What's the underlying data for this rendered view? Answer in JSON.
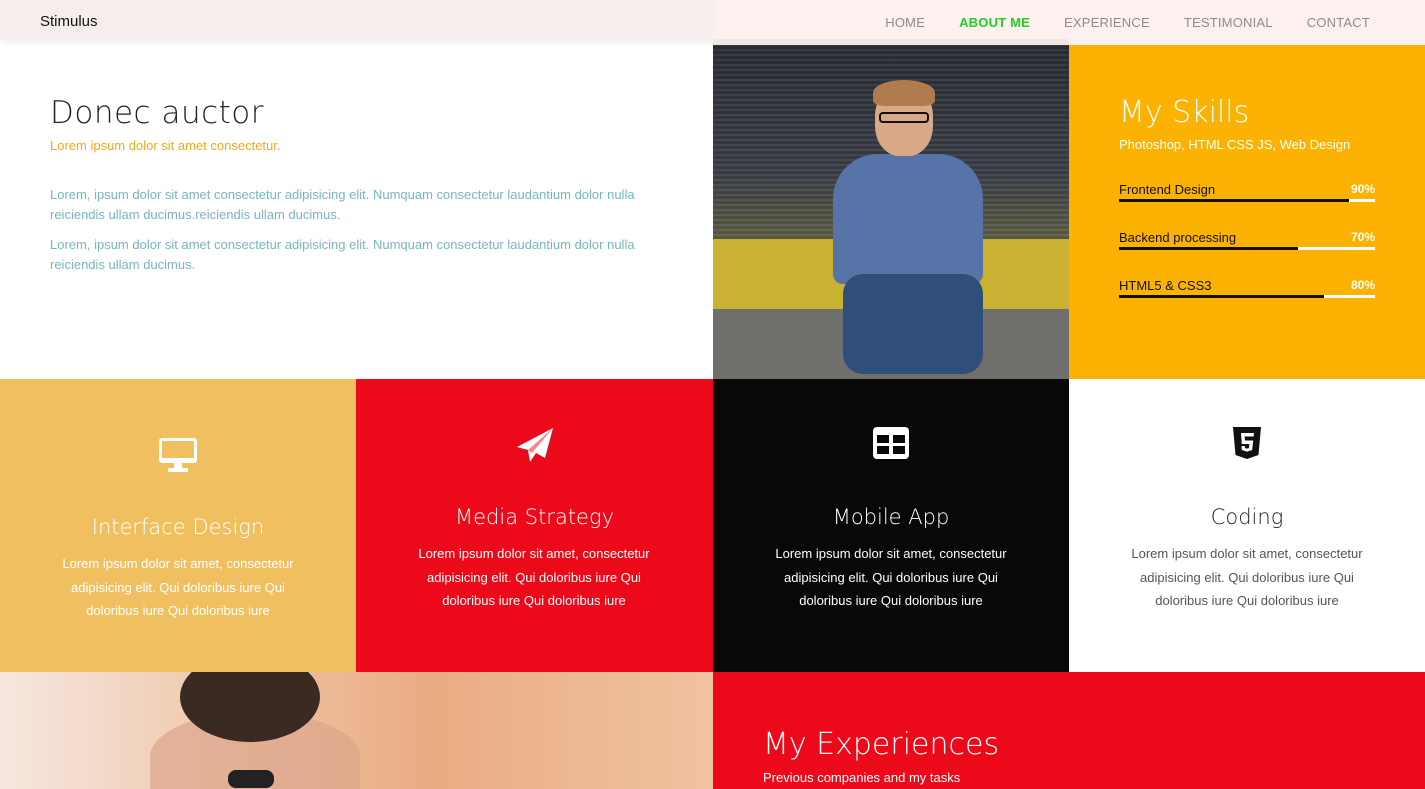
{
  "nav": {
    "brand": "Stimulus",
    "items": [
      {
        "label": "HOME"
      },
      {
        "label": "ABOUT ME"
      },
      {
        "label": "EXPERIENCE"
      },
      {
        "label": "TESTIMONIAL"
      },
      {
        "label": "CONTACT"
      }
    ],
    "active_index": 1,
    "active_color": "#1ed11e"
  },
  "about": {
    "title": "Donec auctor",
    "subtitle": "Lorem ipsum dolor sit amet consectetur.",
    "paragraphs": [
      "Lorem, ipsum dolor sit amet consectetur adipisicing elit. Numquam consectetur laudantium dolor nulla reiciendis ullam ducimus.reiciendis ullam ducimus.",
      "Lorem, ipsum dolor sit amet consectetur adipisicing elit. Numquam consectetur laudantium dolor nulla reiciendis ullam ducimus."
    ]
  },
  "skills": {
    "title": "My Skills",
    "subtitle": "Photoshop, HTML CSS JS, Web Design",
    "items": [
      {
        "name": "Frontend Design",
        "percent": "90%",
        "value": 0.9
      },
      {
        "name": "Backend processing",
        "percent": "70%",
        "value": 0.7
      },
      {
        "name": "HTML5 & CSS3",
        "percent": "80%",
        "value": 0.8
      }
    ],
    "bg_color": "#fbb203"
  },
  "services": [
    {
      "title": "Interface Design",
      "text": "Lorem ipsum dolor sit amet, consectetur adipisicing elit. Qui doloribus iure Qui doloribus iure Qui doloribus iure",
      "icon": "desktop-icon",
      "bg": "#f0c060"
    },
    {
      "title": "Media Strategy",
      "text": "Lorem ipsum dolor sit amet, consectetur adipisicing elit. Qui doloribus iure Qui doloribus iure Qui doloribus iure",
      "icon": "paper-plane-icon",
      "bg": "#ec0a1a"
    },
    {
      "title": "Mobile App",
      "text": "Lorem ipsum dolor sit amet, consectetur adipisicing elit. Qui doloribus iure Qui doloribus iure Qui doloribus iure",
      "icon": "table-icon",
      "bg": "#0a0806"
    },
    {
      "title": "Coding",
      "text": "Lorem ipsum dolor sit amet, consectetur adipisicing elit. Qui doloribus iure Qui doloribus iure Qui doloribus iure",
      "icon": "html5-icon",
      "bg": "#ffffff"
    }
  ],
  "experience": {
    "title": "My Experiences",
    "subtitle": "Previous companies and my tasks"
  }
}
